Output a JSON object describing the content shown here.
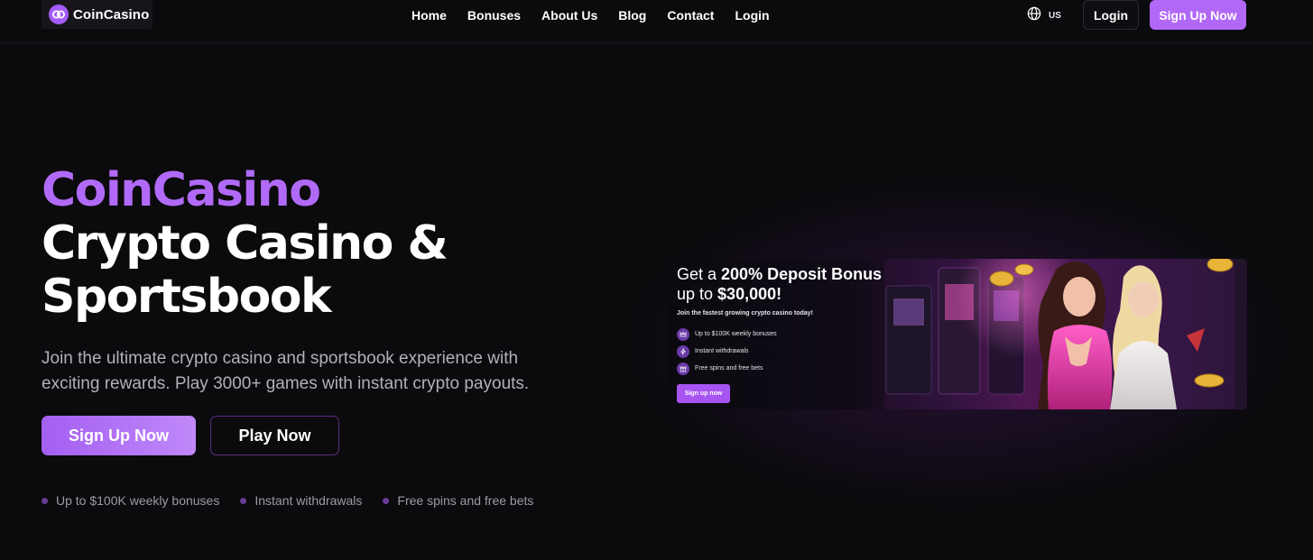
{
  "header": {
    "logo_text": "CoinCasino",
    "nav": [
      "Home",
      "Bonuses",
      "About Us",
      "Blog",
      "Contact",
      "Login"
    ],
    "lang_code": "US",
    "login_label": "Login",
    "signup_label": "Sign Up Now"
  },
  "hero": {
    "brand": "CoinCasino",
    "title_line1": "Crypto Casino &",
    "title_line2": "Sportsbook",
    "subtitle": "Join the ultimate crypto casino and sportsbook experience with exciting rewards. Play 3000+ games with instant crypto payouts.",
    "signup_label": "Sign Up Now",
    "play_label": "Play Now",
    "features": [
      "Up to $100K weekly bonuses",
      "Instant withdrawals",
      "Free spins and free bets"
    ]
  },
  "banner": {
    "head_prefix": "Get a ",
    "head_bold": "200% Deposit Bonus",
    "head_line2_prefix": "up to ",
    "head_line2_bold": "$30,000!",
    "tagline": "Join the fastest growing crypto casino today!",
    "items": [
      "Up to $100K weekly bonuses",
      "Instant withdrawals",
      "Free spins and free bets"
    ],
    "button_label": "Sign up now"
  },
  "colors": {
    "accent": "#b16af7",
    "background": "#0b0a0d",
    "muted_text": "#b3b0ba"
  },
  "icons": {
    "logo": "linked-rings-icon",
    "lang": "globe-icon",
    "banner_items": [
      "crown-icon",
      "lightning-icon",
      "gift-icon"
    ]
  }
}
